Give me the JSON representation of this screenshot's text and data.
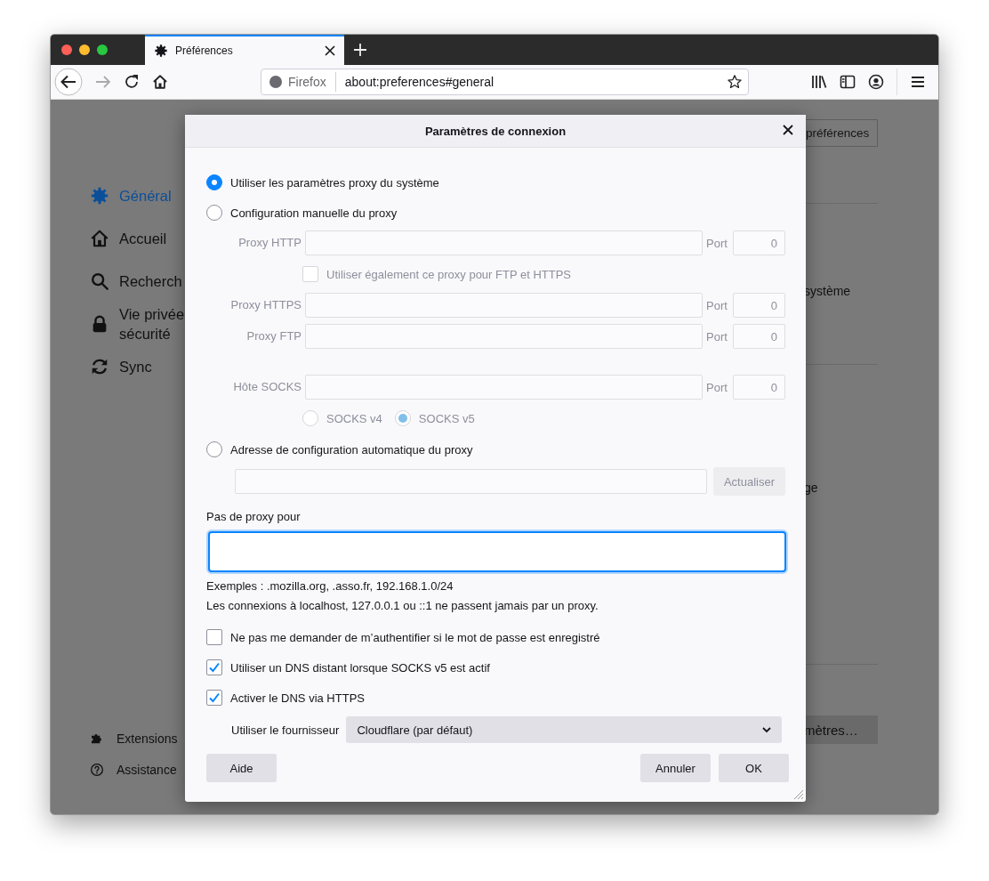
{
  "window": {
    "tab": {
      "title": "Préférences",
      "selected": true
    }
  },
  "toolbar": {
    "identity": "Firefox",
    "url": "about:preferences#general"
  },
  "sidebar": {
    "items": [
      {
        "kind": "gear",
        "label": "Général",
        "selected": true
      },
      {
        "kind": "home",
        "label": "Accueil",
        "selected": false
      },
      {
        "kind": "search",
        "label": "Recherch",
        "selected": false
      },
      {
        "kind": "lock",
        "label": "Vie privée\nsécurité",
        "selected": false
      },
      {
        "kind": "sync",
        "label": "Sync",
        "selected": false
      }
    ],
    "footer": [
      {
        "kind": "puzzle",
        "label": "Extensions"
      },
      {
        "kind": "help",
        "label": "Assistance"
      }
    ]
  },
  "page_right": {
    "button_1": "préférences",
    "text_1": "système",
    "text_2": "ge",
    "button_2": "mètres…"
  },
  "dialog": {
    "title": "Paramètres de connexion",
    "proxy_modes": [
      {
        "label": "Utiliser les paramètres proxy du système",
        "selected": true
      },
      {
        "label": "Configuration manuelle du proxy",
        "selected": false
      },
      {
        "label": "Adresse de configuration automatique du proxy",
        "selected": false
      }
    ],
    "manual": {
      "disabled": true,
      "http": {
        "label": "Proxy HTTP",
        "port_label": "Port",
        "port": "0"
      },
      "share": {
        "label": "Utiliser également ce proxy pour FTP et HTTPS",
        "checked": false
      },
      "https": {
        "label": "Proxy HTTPS",
        "port_label": "Port",
        "port": "0"
      },
      "ftp": {
        "label": "Proxy FTP",
        "port_label": "Port",
        "port": "0"
      },
      "socks": {
        "label": "Hôte SOCKS",
        "port_label": "Port",
        "port": "0"
      },
      "socks_versions": [
        {
          "label": "SOCKS v4",
          "selected": false
        },
        {
          "label": "SOCKS v5",
          "selected": true
        }
      ]
    },
    "auto": {
      "disabled": true,
      "button": "Actualiser"
    },
    "no_proxy": {
      "label": "Pas de proxy pour",
      "focused": true
    },
    "hints": [
      "Exemples : .mozilla.org, .asso.fr, 192.168.1.0/24",
      "Les connexions à localhost, 127.0.0.1 ou ::1 ne passent jamais par un proxy."
    ],
    "options": [
      {
        "label": "Ne pas me demander de m’authentifier si le mot de passe est enregistré",
        "checked": false
      },
      {
        "label": "Utiliser un DNS distant lorsque SOCKS v5 est actif",
        "checked": true
      },
      {
        "label": "Activer le DNS via HTTPS",
        "checked": true
      }
    ],
    "provider": {
      "label": "Utiliser le fournisseur",
      "value": "Cloudflare (par défaut)"
    },
    "buttons": {
      "help": "Aide",
      "cancel": "Annuler",
      "ok": "OK"
    }
  }
}
